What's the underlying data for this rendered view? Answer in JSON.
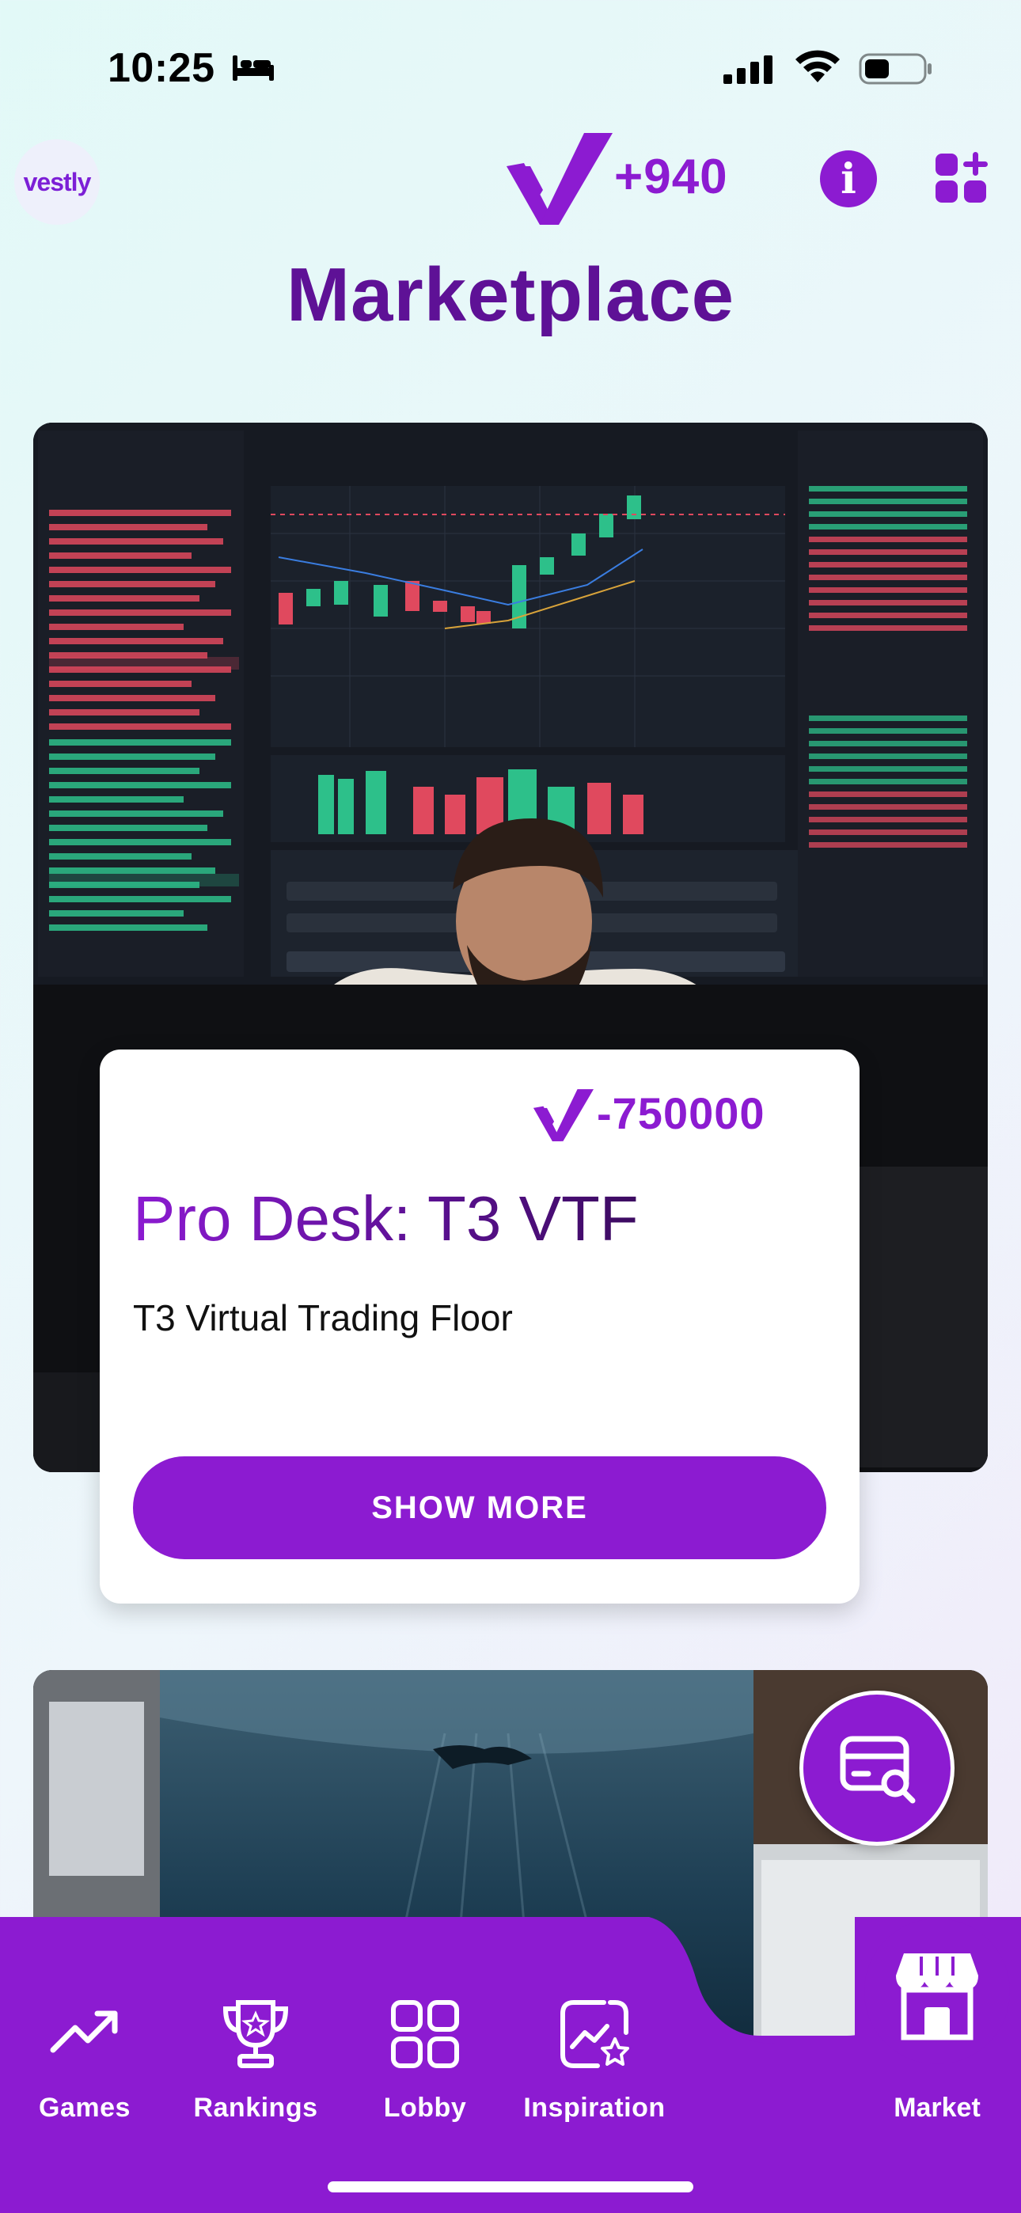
{
  "status_bar": {
    "time": "10:25",
    "icons": [
      "bed-icon",
      "cellular-signal-icon",
      "wifi-icon",
      "battery-icon"
    ]
  },
  "header": {
    "logo_text": "vestly",
    "points": "+940",
    "points_icon": "vestly-v-icon",
    "info_icon": "info-icon",
    "add_icon": "add-widget-icon"
  },
  "page": {
    "title": "Marketplace"
  },
  "product": {
    "price": "-750000",
    "price_icon": "vestly-v-icon",
    "title": "Pro Desk: T3 VTF",
    "subtitle": "T3 Virtual Trading Floor",
    "button_label": "SHOW MORE"
  },
  "tabs": [
    {
      "label": "Games",
      "icon": "trending-up-icon"
    },
    {
      "label": "Rankings",
      "icon": "trophy-icon"
    },
    {
      "label": "Lobby",
      "icon": "grid-icon"
    },
    {
      "label": "Inspiration",
      "icon": "image-star-icon"
    },
    {
      "label": "Market",
      "icon": "storefront-icon",
      "active": true
    }
  ],
  "colors": {
    "accent": "#8c1bd1",
    "accent_dark": "#5e1196"
  }
}
